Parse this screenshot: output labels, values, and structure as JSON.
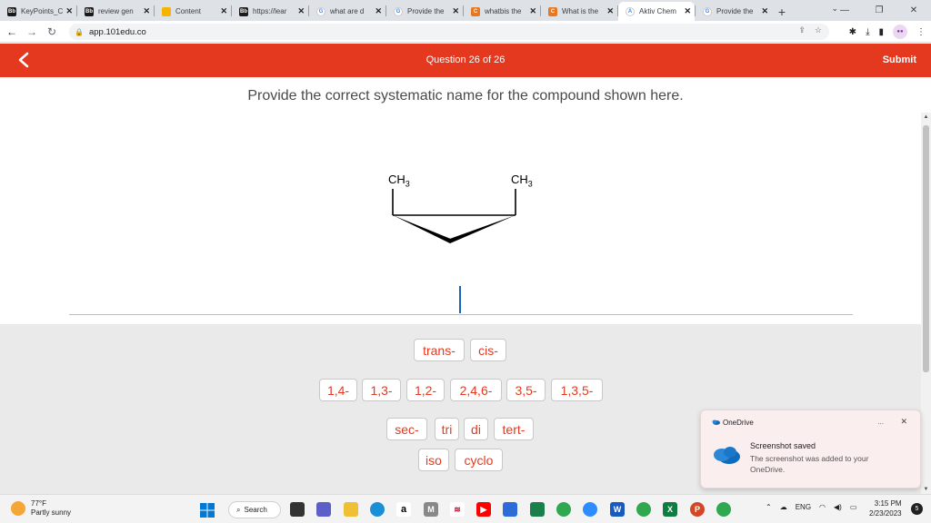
{
  "browser": {
    "tabs": [
      {
        "label": "KeyPoints_C",
        "icon": "blackboard-icon",
        "color": "#1a1a1a",
        "glyph": "Bb"
      },
      {
        "label": "review gen",
        "icon": "blackboard-icon",
        "color": "#1a1a1a",
        "glyph": "Bb"
      },
      {
        "label": "Content",
        "icon": "content-icon",
        "color": "#f4b400",
        "glyph": ""
      },
      {
        "label": "https://lear",
        "icon": "blackboard-icon",
        "color": "#1a1a1a",
        "glyph": "Bb"
      },
      {
        "label": "what are d",
        "icon": "google-icon",
        "color": "#ffffff",
        "glyph": "G"
      },
      {
        "label": "Provide the",
        "icon": "google-icon",
        "color": "#ffffff",
        "glyph": "G"
      },
      {
        "label": "whatbis the",
        "icon": "chegg-icon",
        "color": "#e87722",
        "glyph": "C"
      },
      {
        "label": "What is the",
        "icon": "chegg-icon",
        "color": "#e87722",
        "glyph": "C"
      },
      {
        "label": "Aktiv Chem",
        "icon": "aktiv-icon",
        "color": "#ffffff",
        "glyph": "A",
        "active": true
      },
      {
        "label": "Provide the",
        "icon": "google-icon",
        "color": "#ffffff",
        "glyph": "G"
      }
    ],
    "new_tab": "+",
    "url": "app.101edu.co"
  },
  "app": {
    "question_counter": "Question 26 of 26",
    "submit_label": "Submit",
    "prompt": "Provide the correct systematic name for the compound shown here.",
    "structure_labels": [
      "CH",
      "3"
    ],
    "tiles_row1": [
      "trans-",
      "cis-"
    ],
    "tiles_row2": [
      "1,4-",
      "1,3-",
      "1,2-",
      "2,4,6-",
      "3,5-",
      "1,3,5-"
    ],
    "tiles_row3": [
      "sec-",
      "tri",
      "di",
      "tert-"
    ],
    "tiles_row4": [
      "iso",
      "cyclo"
    ],
    "accent": "#e5391f"
  },
  "notification": {
    "app_name": "OneDrive",
    "more": "...",
    "title": "Screenshot saved",
    "body": "The screenshot was added to your OneDrive."
  },
  "taskbar": {
    "temperature": "77°F",
    "weather": "Partly sunny",
    "search": "Search",
    "language": "ENG",
    "time": "3:15 PM",
    "date": "2/23/2023",
    "badge": "5"
  }
}
